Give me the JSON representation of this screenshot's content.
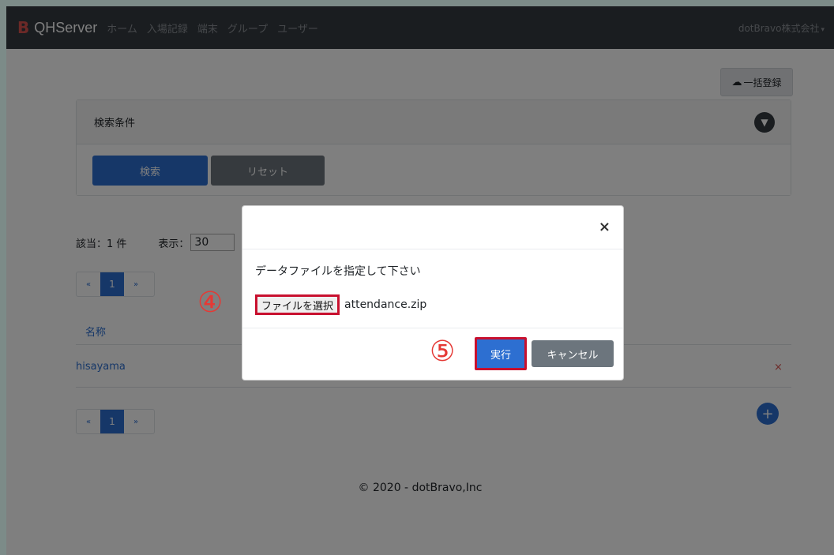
{
  "navbar": {
    "logo": "B",
    "brand": "QHServer",
    "links": [
      "ホーム",
      "入場記録",
      "端末",
      "グループ",
      "ユーザー"
    ],
    "company": "dotBravo株式会社"
  },
  "actions": {
    "bulk_register": "一括登録"
  },
  "search": {
    "title": "検索条件",
    "search_label": "検索",
    "reset_label": "リセット"
  },
  "results": {
    "count_label": "該当：1 件",
    "display_label": "表示：",
    "display_value": "30",
    "pagination": {
      "prev": "«",
      "page": "1",
      "next": "»"
    },
    "column_name": "名称",
    "rows": [
      {
        "name": "hisayama",
        "delete": "×"
      }
    ]
  },
  "footer": "© 2020 - dotBravo,Inc",
  "modal": {
    "close": "×",
    "message": "データファイルを指定して下さい",
    "file_button": "ファイルを選択",
    "file_name": "attendance.zip",
    "execute_label": "実行",
    "cancel_label": "キャンセル"
  },
  "annotations": {
    "step4": "④",
    "step5": "⑤"
  },
  "colors": {
    "primary": "#2d6fd1",
    "secondary": "#6c757d",
    "navbar": "#343a40",
    "highlight": "#c8102e",
    "annotation": "#e53935"
  }
}
